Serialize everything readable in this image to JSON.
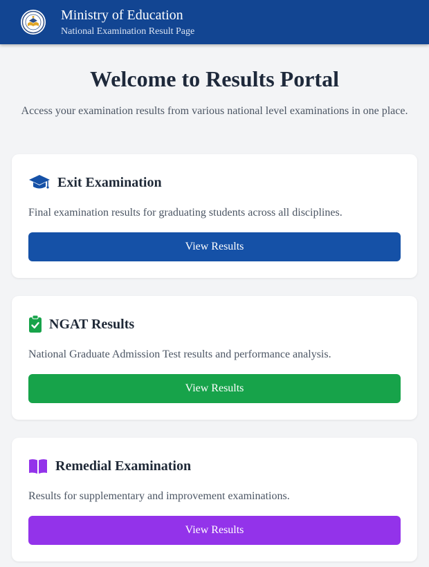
{
  "header": {
    "title": "Ministry of Education",
    "subtitle": "National Examination Result Page"
  },
  "main": {
    "title": "Welcome to Results Portal",
    "description": "Access your examination results from various national level examinations in one place."
  },
  "cards": [
    {
      "icon": "graduation-cap-icon",
      "title": "Exit Examination",
      "description": "Final examination results for graduating students across all disciplines.",
      "button_label": "View Results",
      "color": "#1551a7"
    },
    {
      "icon": "clipboard-check-icon",
      "title": "NGAT Results",
      "description": "National Graduate Admission Test results and performance analysis.",
      "button_label": "View Results",
      "color": "#17a34a"
    },
    {
      "icon": "open-book-icon",
      "title": "Remedial Examination",
      "description": "Results for supplementary and improvement examinations.",
      "button_label": "View Results",
      "color": "#9333ea"
    }
  ]
}
